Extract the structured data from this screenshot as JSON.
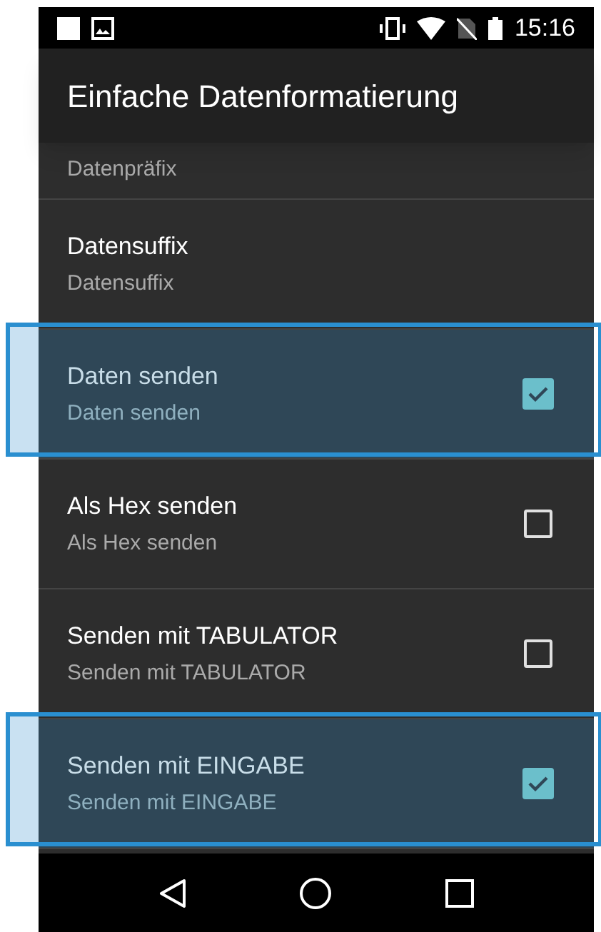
{
  "status_bar": {
    "time": "15:16"
  },
  "toolbar": {
    "title": "Einfache Datenformatierung"
  },
  "items": [
    {
      "kind": "text",
      "summary": "Datenpräfix",
      "highlighted": false
    },
    {
      "kind": "text",
      "title": "Datensuffix",
      "summary": "Datensuffix",
      "highlighted": false
    },
    {
      "kind": "checkbox",
      "title": "Daten senden",
      "summary": "Daten senden",
      "checked": true,
      "highlighted": true
    },
    {
      "kind": "checkbox",
      "title": "Als Hex senden",
      "summary": "Als Hex senden",
      "checked": false,
      "highlighted": false
    },
    {
      "kind": "checkbox",
      "title": "Senden mit TABULATOR",
      "summary": "Senden mit TABULATOR",
      "checked": false,
      "highlighted": false
    },
    {
      "kind": "checkbox",
      "title": "Senden mit EINGABE",
      "summary": "Senden mit EINGABE",
      "checked": true,
      "highlighted": true
    }
  ]
}
